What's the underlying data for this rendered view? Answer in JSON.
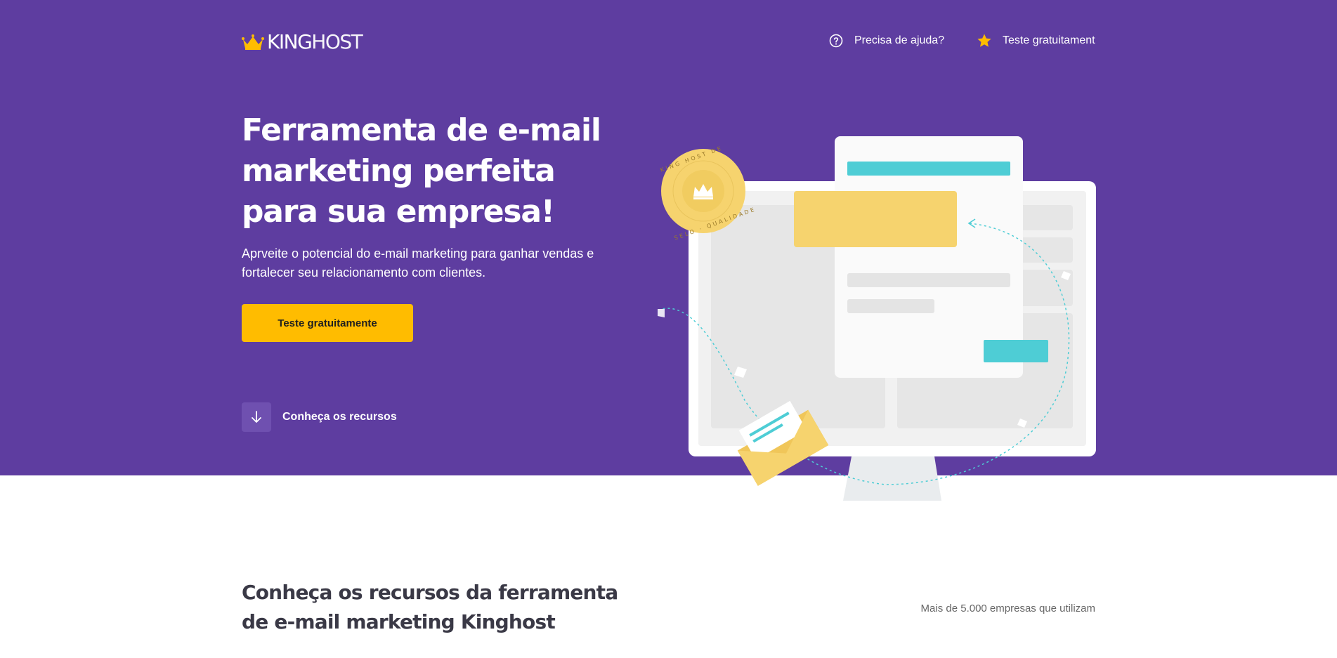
{
  "header": {
    "logo": {
      "part1": "KING",
      "part2": "HOST"
    },
    "nav": {
      "help_label": "Precisa de ajuda?",
      "trial_label": "Teste gratuitament"
    }
  },
  "hero": {
    "title": "Ferramenta de e-mail marketing perfeita para sua empresa!",
    "subtitle": "Aprveite o potencial do e-mail marketing para ganhar vendas e fortalecer seu relacionamento com clientes.",
    "cta_label": "Teste gratuitamente",
    "features_link_label": "Conheça os recursos",
    "seal_text": "SELO KING HOST DE QUALIDADE"
  },
  "features": {
    "title": "Conheça os recursos da ferramenta de e-mail marketing Kinghost",
    "companies_text": "Mais de 5.000 empresas que utilizam"
  },
  "colors": {
    "hero_bg": "#5e3da0",
    "cta": "#ffbc00",
    "accent_teal": "#4ecdd5",
    "accent_yellow": "#f6d36e"
  },
  "icons": {
    "logo": "crown-icon",
    "help": "question-circle-icon",
    "trial": "star-icon",
    "features": "arrow-down-icon"
  }
}
